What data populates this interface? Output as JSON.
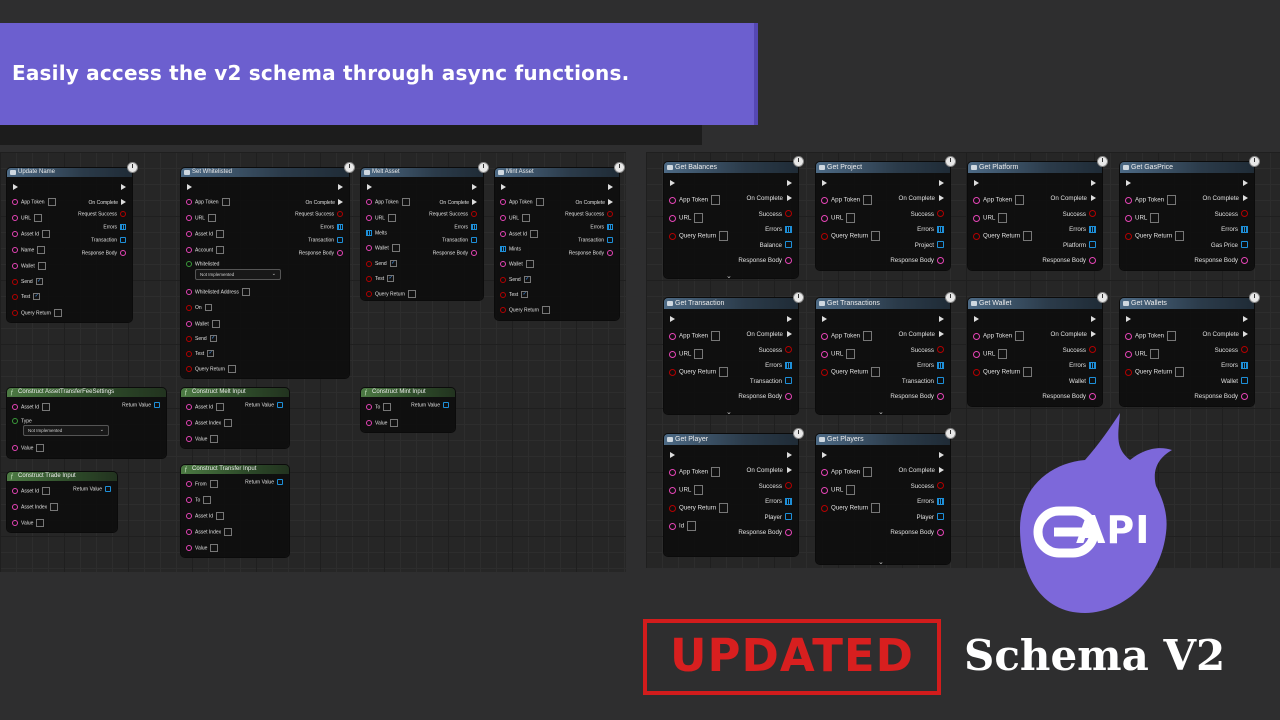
{
  "banner": {
    "text": "Easily access the v2 schema through async functions."
  },
  "branding": {
    "logo_text": "API",
    "updated_label": "UPDATED",
    "schema_label": "Schema V2",
    "accent_color": "#6c5fcf",
    "stamp_color": "#d21c1c"
  },
  "left_nodes": {
    "update_name": {
      "title": "Update Name",
      "inputs": [
        "App Token",
        "URL",
        "Asset Id",
        "Name",
        "Wallet",
        "Send",
        "Test",
        "Query Return"
      ],
      "outputs": [
        "On Complete",
        "Request Success",
        "Errors",
        "Transaction",
        "Response Body"
      ]
    },
    "set_whitelisted": {
      "title": "Set Whitelisted",
      "inputs": [
        "App Token",
        "URL",
        "Asset Id",
        "Account",
        "Whitelisted",
        "Whitelisted Address",
        "On",
        "Wallet",
        "Send",
        "Test",
        "Query Return"
      ],
      "dropdown": "Not Implemented",
      "outputs": [
        "On Complete",
        "Request Success",
        "Errors",
        "Transaction",
        "Response Body"
      ]
    },
    "melt_asset": {
      "title": "Melt Asset",
      "inputs": [
        "App Token",
        "URL",
        "Melts",
        "Wallet",
        "Send",
        "Test",
        "Query Return"
      ],
      "outputs": [
        "On Complete",
        "Request Success",
        "Errors",
        "Transaction",
        "Response Body"
      ]
    },
    "mint_asset": {
      "title": "Mint Asset",
      "inputs": [
        "App Token",
        "URL",
        "Asset Id",
        "Mints",
        "Wallet",
        "Send",
        "Test",
        "Query Return"
      ],
      "outputs": [
        "On Complete",
        "Request Success",
        "Errors",
        "Transaction",
        "Response Body"
      ]
    },
    "construct_fee": {
      "title": "Construct AssetTransferFeeSettings",
      "inputs": [
        "Asset Id",
        "Type",
        "Value"
      ],
      "dropdown": "Not Implemented",
      "output": "Return Value"
    },
    "construct_melt": {
      "title": "Construct Melt Input",
      "inputs": [
        "Asset Id",
        "Asset Index",
        "Value"
      ],
      "output": "Return Value"
    },
    "construct_mint": {
      "title": "Construct Mint Input",
      "inputs": [
        "To",
        "Value"
      ],
      "output": "Return Value"
    },
    "construct_trade": {
      "title": "Construct Trade Input",
      "inputs": [
        "Asset Id",
        "Asset Index",
        "Value"
      ],
      "output": "Return Value"
    },
    "construct_transfer": {
      "title": "Construct Transfer Input",
      "inputs": [
        "From",
        "To",
        "Asset Id",
        "Asset Index",
        "Value"
      ],
      "output": "Return Value"
    }
  },
  "right_nodes": [
    {
      "title": "Get Balances",
      "inputs": [
        "App Token",
        "URL",
        "Query Return"
      ],
      "outputs": [
        "On Complete",
        "Success",
        "Errors",
        "Balance",
        "Response Body"
      ]
    },
    {
      "title": "Get Project",
      "inputs": [
        "App Token",
        "URL",
        "Query Return"
      ],
      "outputs": [
        "On Complete",
        "Success",
        "Errors",
        "Project",
        "Response Body"
      ]
    },
    {
      "title": "Get Platform",
      "inputs": [
        "App Token",
        "URL",
        "Query Return"
      ],
      "outputs": [
        "On Complete",
        "Success",
        "Errors",
        "Platform",
        "Response Body"
      ]
    },
    {
      "title": "Get GasPrice",
      "inputs": [
        "App Token",
        "URL",
        "Query Return"
      ],
      "outputs": [
        "On Complete",
        "Success",
        "Errors",
        "Gas Price",
        "Response Body"
      ]
    },
    {
      "title": "Get Transaction",
      "inputs": [
        "App Token",
        "URL",
        "Query Return"
      ],
      "outputs": [
        "On Complete",
        "Success",
        "Errors",
        "Transaction",
        "Response Body"
      ]
    },
    {
      "title": "Get Transactions",
      "inputs": [
        "App Token",
        "URL",
        "Query Return"
      ],
      "outputs": [
        "On Complete",
        "Success",
        "Errors",
        "Transaction",
        "Response Body"
      ]
    },
    {
      "title": "Get Wallet",
      "inputs": [
        "App Token",
        "URL",
        "Query Return"
      ],
      "outputs": [
        "On Complete",
        "Success",
        "Errors",
        "Wallet",
        "Response Body"
      ]
    },
    {
      "title": "Get Wallets",
      "inputs": [
        "App Token",
        "URL",
        "Query Return"
      ],
      "outputs": [
        "On Complete",
        "Success",
        "Errors",
        "Wallet",
        "Response Body"
      ]
    },
    {
      "title": "Get Player",
      "inputs": [
        "App Token",
        "URL",
        "Query Return",
        "Id"
      ],
      "outputs": [
        "On Complete",
        "Success",
        "Errors",
        "Player",
        "Response Body"
      ]
    },
    {
      "title": "Get Players",
      "inputs": [
        "App Token",
        "URL",
        "Query Return"
      ],
      "outputs": [
        "On Complete",
        "Success",
        "Errors",
        "Player",
        "Response Body"
      ]
    }
  ]
}
